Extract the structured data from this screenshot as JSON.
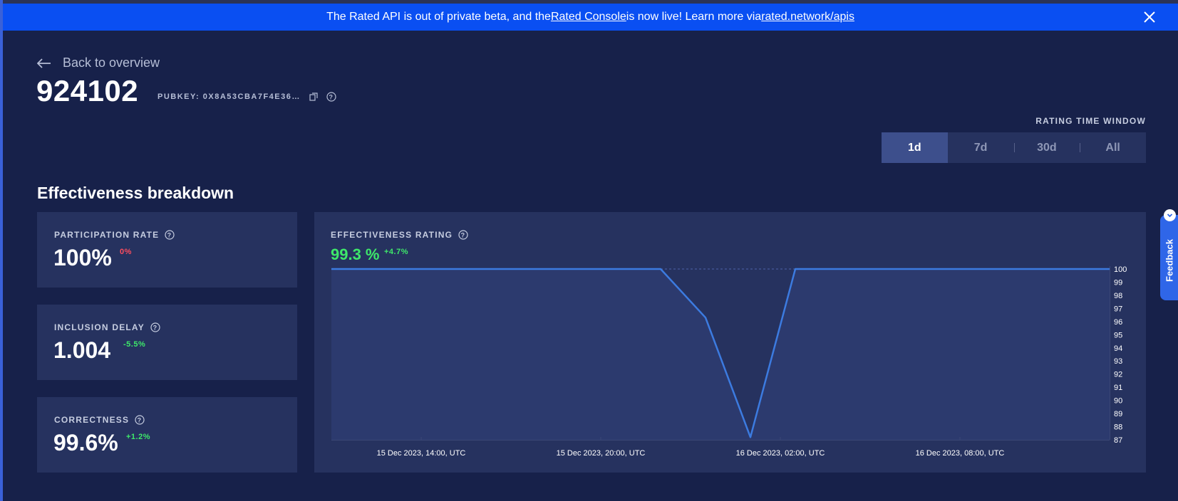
{
  "banner": {
    "text_1": "The Rated API is out of private beta, and the ",
    "link_1": "Rated Console",
    "text_2": " is now live! Learn more via ",
    "link_2": "rated.network/apis"
  },
  "header": {
    "back_label": "Back to overview",
    "validator_index": "924102",
    "pubkey_label": "PUBKEY: 0X8A53CBA7F4E36…"
  },
  "time_window": {
    "label": "RATING TIME WINDOW",
    "options": [
      "1d",
      "7d",
      "30d",
      "All"
    ],
    "selected": "1d"
  },
  "section_title": "Effectiveness breakdown",
  "metrics": [
    {
      "label": "PARTICIPATION RATE",
      "value": "100%",
      "delta": "0%",
      "delta_color": "#ff4d5e"
    },
    {
      "label": "INCLUSION DELAY",
      "value": "1.004",
      "delta": "-5.5%",
      "delta_color": "#3ee86a"
    },
    {
      "label": "CORRECTNESS",
      "value": "99.6%",
      "delta": "+1.2%",
      "delta_color": "#3ee86a"
    }
  ],
  "effectiveness": {
    "label": "EFFECTIVENESS RATING",
    "value": "99.3 %",
    "delta": "+4.7%"
  },
  "chart_data": {
    "type": "area",
    "title": "EFFECTIVENESS RATING",
    "x": [
      "15 Dec 2023, 11:00, UTC",
      "15 Dec 2023, 22:00, UTC",
      "15 Dec 2023, 23:30, UTC",
      "16 Dec 2023, 01:00, UTC",
      "16 Dec 2023, 02:30, UTC",
      "16 Dec 2023, 13:00, UTC"
    ],
    "y": [
      100,
      100,
      96.3,
      87.2,
      100,
      100
    ],
    "x_tick_labels": [
      "15 Dec 2023, 14:00, UTC",
      "15 Dec 2023, 20:00, UTC",
      "16 Dec 2023, 02:00, UTC",
      "16 Dec 2023, 08:00, UTC"
    ],
    "y_tick_labels": [
      "100",
      "99",
      "98",
      "97",
      "96",
      "95",
      "94",
      "93",
      "92",
      "91",
      "90",
      "89",
      "88",
      "87"
    ],
    "ylim": [
      87,
      100
    ],
    "line_color": "#3c7be0",
    "grid": false
  },
  "feedback_label": "Feedback",
  "icons": {
    "back": "arrow-left-icon",
    "close": "close-icon",
    "copy": "copy-icon",
    "help": "help-circle-icon",
    "chevron": "chevron-down-icon"
  }
}
